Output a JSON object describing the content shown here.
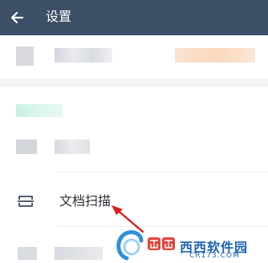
{
  "header": {
    "title": "设置",
    "back_icon": "arrow-left-icon",
    "background": "#3d4f66"
  },
  "scan_item": {
    "label": "文档扫描",
    "icon": "document-scan-icon"
  },
  "annotation": {
    "arrow_icon": "red-pointer-arrow-icon",
    "color": "#d81e1e"
  },
  "watermark": {
    "brand": "西西软件园",
    "domain": "CR173.COM"
  }
}
